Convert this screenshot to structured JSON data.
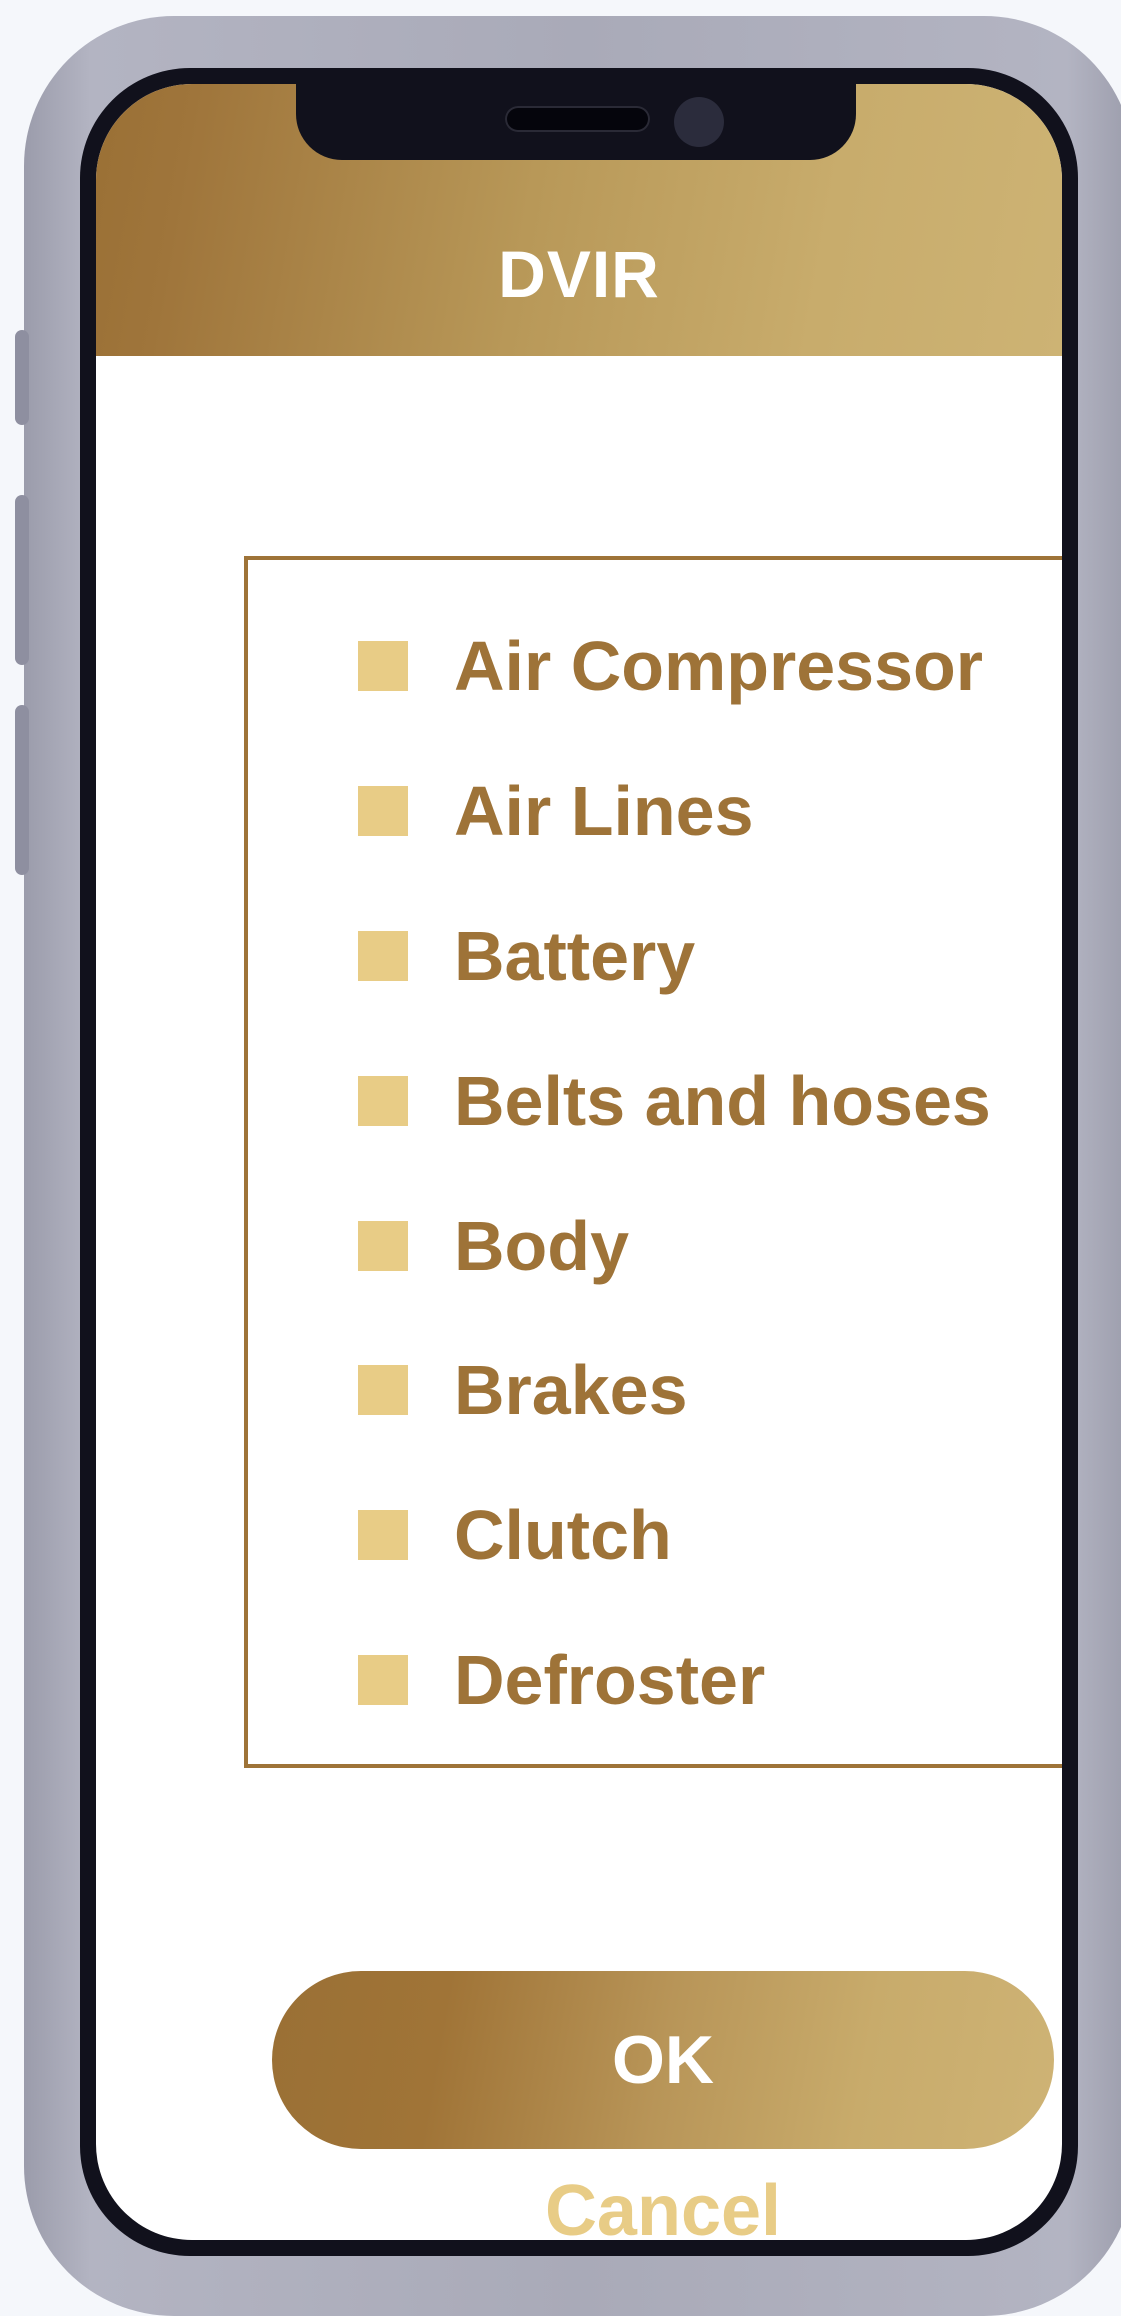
{
  "app": {
    "title": "DVIR"
  },
  "checklist": {
    "items": [
      {
        "label": "Air Compressor",
        "checked": false
      },
      {
        "label": "Air Lines",
        "checked": false
      },
      {
        "label": "Battery",
        "checked": false
      },
      {
        "label": "Belts and hoses",
        "checked": false
      },
      {
        "label": "Body",
        "checked": false
      },
      {
        "label": "Brakes",
        "checked": false
      },
      {
        "label": "Clutch",
        "checked": false
      },
      {
        "label": "Defroster",
        "checked": false
      }
    ]
  },
  "actions": {
    "ok_label": "OK",
    "cancel_label": "Cancel"
  },
  "colors": {
    "brand_gold_dark": "#9e7338",
    "brand_gold_light": "#cdb374",
    "checkbox_fill": "#e8cc86",
    "device_frame": "#a9aab8"
  }
}
